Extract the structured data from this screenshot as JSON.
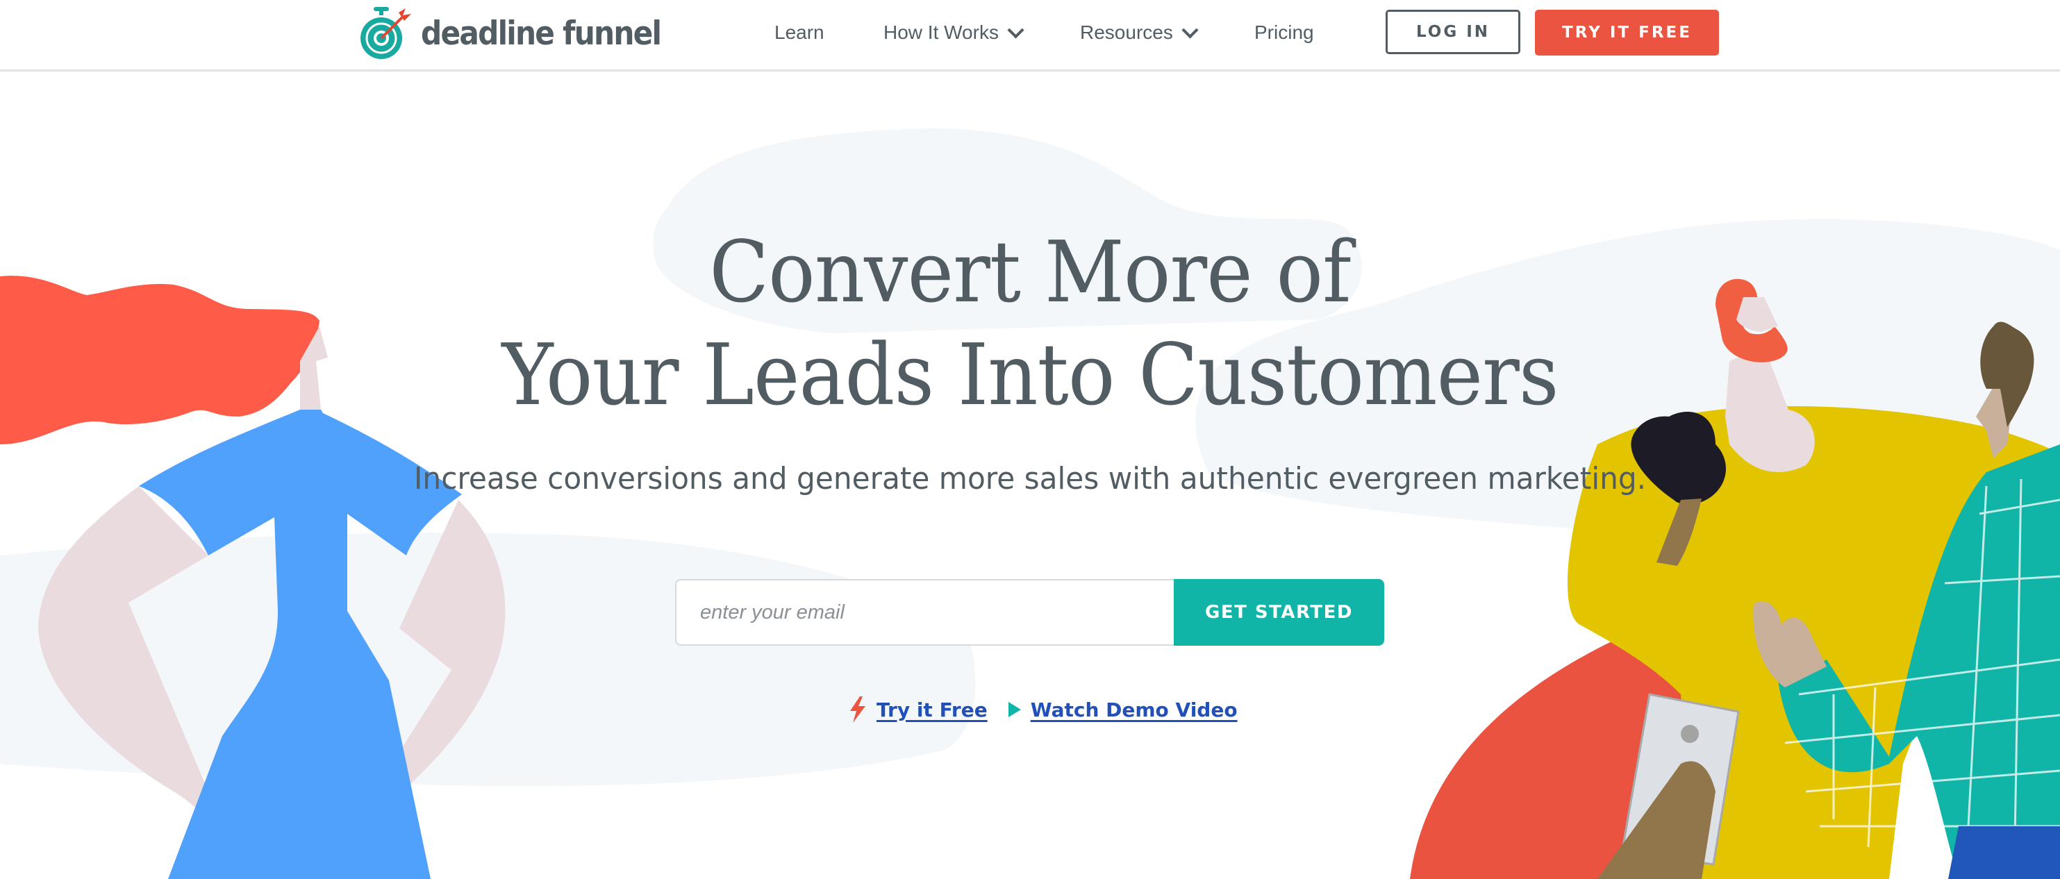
{
  "header": {
    "logo_text": "deadline funnel",
    "nav": [
      {
        "label": "Learn",
        "has_dropdown": false
      },
      {
        "label": "How It Works",
        "has_dropdown": true
      },
      {
        "label": "Resources",
        "has_dropdown": true
      },
      {
        "label": "Pricing",
        "has_dropdown": false
      }
    ],
    "login_label": "LOG IN",
    "try_free_label": "TRY IT FREE"
  },
  "hero": {
    "title_line1": "Convert More of",
    "title_line2": "Your Leads Into Customers",
    "subtitle": "Increase conversions and generate more sales with authentic evergreen marketing.",
    "email_placeholder": "enter your email",
    "email_value": "",
    "cta_label": "GET STARTED",
    "link_try_free": "Try it Free",
    "link_demo": "Watch Demo Video"
  },
  "colors": {
    "brand_teal": "#10b5a8",
    "brand_red": "#eb5440",
    "text_gray": "#525c63",
    "link_blue": "#2151b8"
  }
}
